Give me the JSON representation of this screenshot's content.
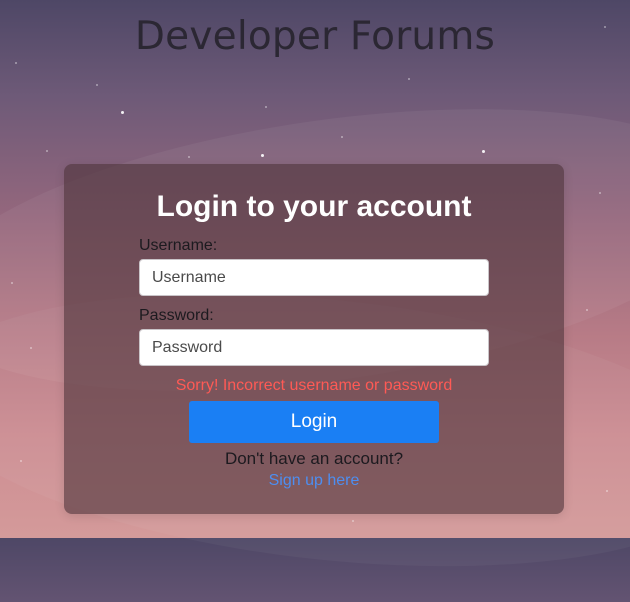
{
  "site": {
    "title": "Developer Forums"
  },
  "login": {
    "heading": "Login to your account",
    "username_label": "Username:",
    "username_placeholder": "Username",
    "username_value": "",
    "password_label": "Password:",
    "password_placeholder": "Password",
    "password_value": "",
    "error_message": "Sorry! Incorrect username or password",
    "login_button": "Login",
    "no_account_text": "Don't have an account?",
    "signup_link": "Sign up here"
  },
  "colors": {
    "button": "#1a7ff4",
    "error": "#ff5a55",
    "link": "#4d8ef0",
    "heading": "#ffffff"
  }
}
